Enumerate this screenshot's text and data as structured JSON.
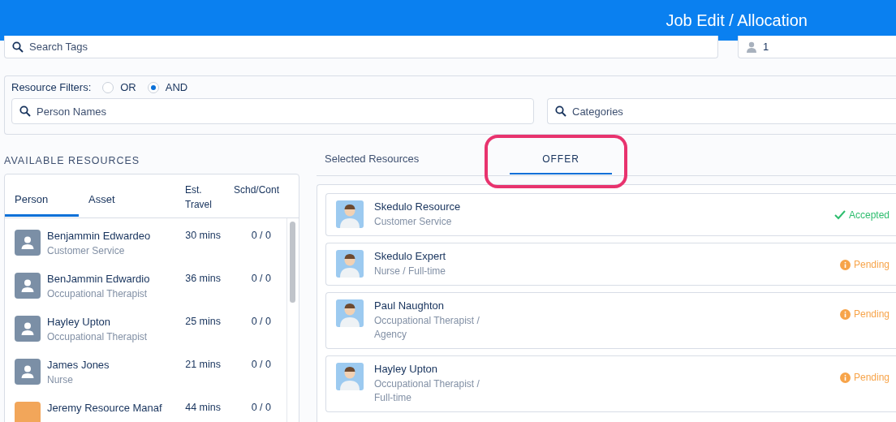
{
  "header": {
    "title": "Job Edit / Allocation"
  },
  "search": {
    "placeholder": "Search Tags"
  },
  "count_field": {
    "value": "1"
  },
  "filters": {
    "label": "Resource Filters:",
    "options": [
      {
        "label": "OR",
        "selected": false
      },
      {
        "label": "AND",
        "selected": true
      }
    ],
    "person_search": {
      "placeholder": "Person Names"
    },
    "category_search": {
      "placeholder": "Categories"
    }
  },
  "available": {
    "title": "AVAILABLE RESOURCES",
    "tabs": [
      {
        "label": "Person",
        "selected": true
      },
      {
        "label": "Asset",
        "selected": false
      }
    ],
    "columns": [
      "Est. Travel",
      "Schd/Cont"
    ],
    "rows": [
      {
        "name": "Benjammin Edwardeo",
        "role": "Customer Service",
        "travel": "30 mins",
        "schedule": "0 / 0",
        "kind": "generic"
      },
      {
        "name": "BenJammin Edwardio",
        "role": "Occupational Therapist",
        "travel": "36 mins",
        "schedule": "0 / 0",
        "kind": "generic"
      },
      {
        "name": "Hayley Upton",
        "role": "Occupational Therapist",
        "travel": "25 mins",
        "schedule": "0 / 0",
        "kind": "generic"
      },
      {
        "name": "James Jones",
        "role": "Nurse",
        "travel": "21 mins",
        "schedule": "0 / 0",
        "kind": "generic"
      },
      {
        "name": "Jeremy Resource Manaf",
        "travel": "44 mins",
        "schedule": "0 / 0",
        "kind": "photo"
      }
    ]
  },
  "selected_panel": {
    "tabs": [
      {
        "label": "Selected Resources",
        "selected": false
      },
      {
        "label": "OFFER",
        "selected": true,
        "highlighted": true
      }
    ],
    "offers": [
      {
        "name": "Skedulo Resource",
        "role": "Customer Service",
        "status": "Accepted",
        "kind": "accepted"
      },
      {
        "name": "Skedulo Expert",
        "role": "Nurse / Full-time",
        "status": "Pending",
        "kind": "pending"
      },
      {
        "name": "Paul Naughton",
        "role": "Occupational Therapist / Agency",
        "status": "Pending",
        "kind": "pending"
      },
      {
        "name": "Hayley Upton",
        "role": "Occupational Therapist / Full-time",
        "status": "Pending",
        "kind": "pending"
      }
    ]
  }
}
